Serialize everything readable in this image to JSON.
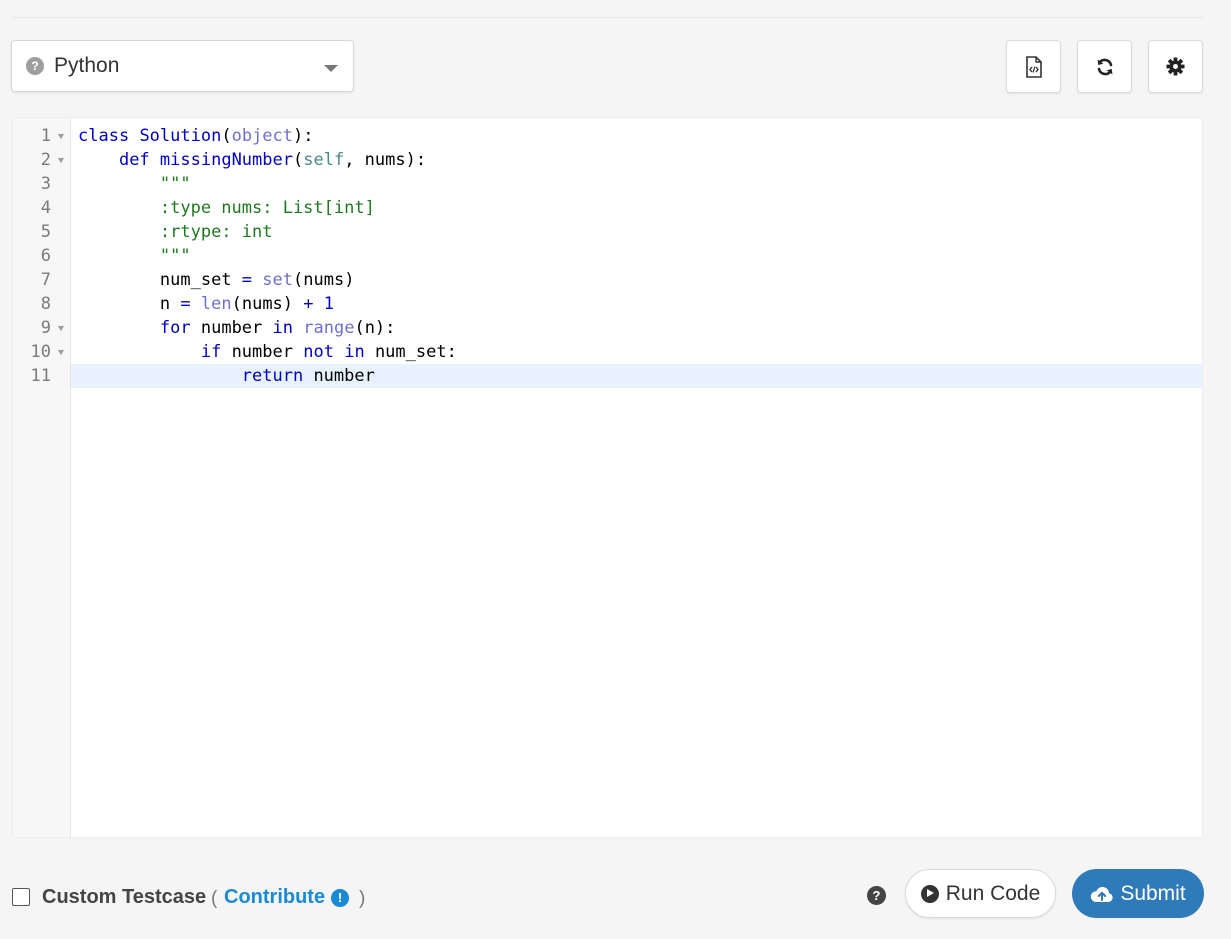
{
  "toolbar": {
    "language": "Python",
    "icons": [
      "question-circle-icon",
      "file-code-icon",
      "refresh-icon",
      "gear-icon"
    ]
  },
  "editor": {
    "lines": [
      {
        "no": "1",
        "fold": true
      },
      {
        "no": "2",
        "fold": true
      },
      {
        "no": "3",
        "fold": false
      },
      {
        "no": "4",
        "fold": false
      },
      {
        "no": "5",
        "fold": false
      },
      {
        "no": "6",
        "fold": false
      },
      {
        "no": "7",
        "fold": false
      },
      {
        "no": "8",
        "fold": false
      },
      {
        "no": "9",
        "fold": true
      },
      {
        "no": "10",
        "fold": true
      },
      {
        "no": "11",
        "fold": false
      }
    ],
    "tokens": {
      "l1": {
        "kw": "class",
        "name": "Solution",
        "p1": "(",
        "base": "object",
        "p2": "):"
      },
      "l2": {
        "kw": "def",
        "name": "missingNumber",
        "p1": "(",
        "self": "self",
        "rest": ", nums):"
      },
      "l3": {
        "doc": "\"\"\""
      },
      "l4": {
        "doc": ":type nums: List[int]"
      },
      "l5": {
        "doc": ":rtype: int"
      },
      "l6": {
        "doc": "\"\"\""
      },
      "l7": {
        "var": "num_set",
        "eq": "=",
        "fn": "set",
        "args": "(nums)"
      },
      "l8": {
        "var": "n",
        "eq": "=",
        "fn": "len",
        "args": "(nums)",
        "plus": "+",
        "num": "1"
      },
      "l9": {
        "kw": "for",
        "var": "number",
        "in": "in",
        "fn": "range",
        "args": "(n):"
      },
      "l10": {
        "kw": "if",
        "var": "number",
        "not": "not",
        "in": "in",
        "target": "num_set:"
      },
      "l11": {
        "kw": "return",
        "var": "number"
      }
    },
    "active_line": 11
  },
  "footer": {
    "custom_testcase_label": "Custom Testcase",
    "open_paren": "(",
    "contribute_label": "Contribute",
    "close_paren": ")",
    "run_label": "Run Code",
    "submit_label": "Submit"
  },
  "colors": {
    "keyword": "#0000cc",
    "builtin": "#6f6fd6",
    "string": "#1e7a1e",
    "link": "#1a8ad4",
    "submit_bg": "#2f7ab9",
    "active_line_bg": "#e8f2ff"
  }
}
